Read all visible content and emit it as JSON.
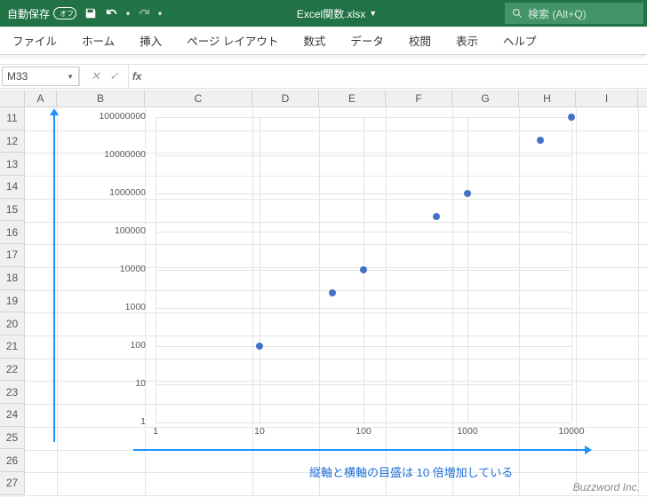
{
  "titlebar": {
    "autosave_label": "自動保存",
    "autosave_state": "オフ",
    "filename": "Excel関数.xlsx",
    "search_placeholder": "検索 (Alt+Q)"
  },
  "ribbon": {
    "tabs": [
      "ファイル",
      "ホーム",
      "挿入",
      "ページ レイアウト",
      "数式",
      "データ",
      "校閲",
      "表示",
      "ヘルプ"
    ]
  },
  "namebox": {
    "value": "M33"
  },
  "formula": {
    "value": ""
  },
  "grid": {
    "cols": [
      {
        "label": "A",
        "w": 36
      },
      {
        "label": "B",
        "w": 99
      },
      {
        "label": "C",
        "w": 121
      },
      {
        "label": "D",
        "w": 75
      },
      {
        "label": "E",
        "w": 75
      },
      {
        "label": "F",
        "w": 75
      },
      {
        "label": "G",
        "w": 75
      },
      {
        "label": "H",
        "w": 64
      },
      {
        "label": "I",
        "w": 70
      }
    ],
    "rows": [
      11,
      12,
      13,
      14,
      15,
      16,
      17,
      18,
      19,
      20,
      21,
      22,
      23,
      24,
      25,
      26,
      27
    ]
  },
  "chart_data": {
    "type": "scatter",
    "x": [
      10,
      50,
      100,
      500,
      1000,
      5000,
      10000
    ],
    "y": [
      100,
      2500,
      10000,
      250000,
      1000000,
      25000000,
      100000000
    ],
    "x_scale": "log",
    "y_scale": "log",
    "x_ticks": [
      1,
      10,
      100,
      1000,
      10000
    ],
    "y_ticks": [
      1,
      10,
      100,
      1000,
      10000,
      100000,
      1000000,
      10000000,
      100000000
    ],
    "xlim": [
      1,
      10000
    ],
    "ylim": [
      1,
      100000000
    ]
  },
  "annotation": "縦軸と横軸の目盛は 10 倍増加している",
  "watermark": "Buzzword Inc."
}
